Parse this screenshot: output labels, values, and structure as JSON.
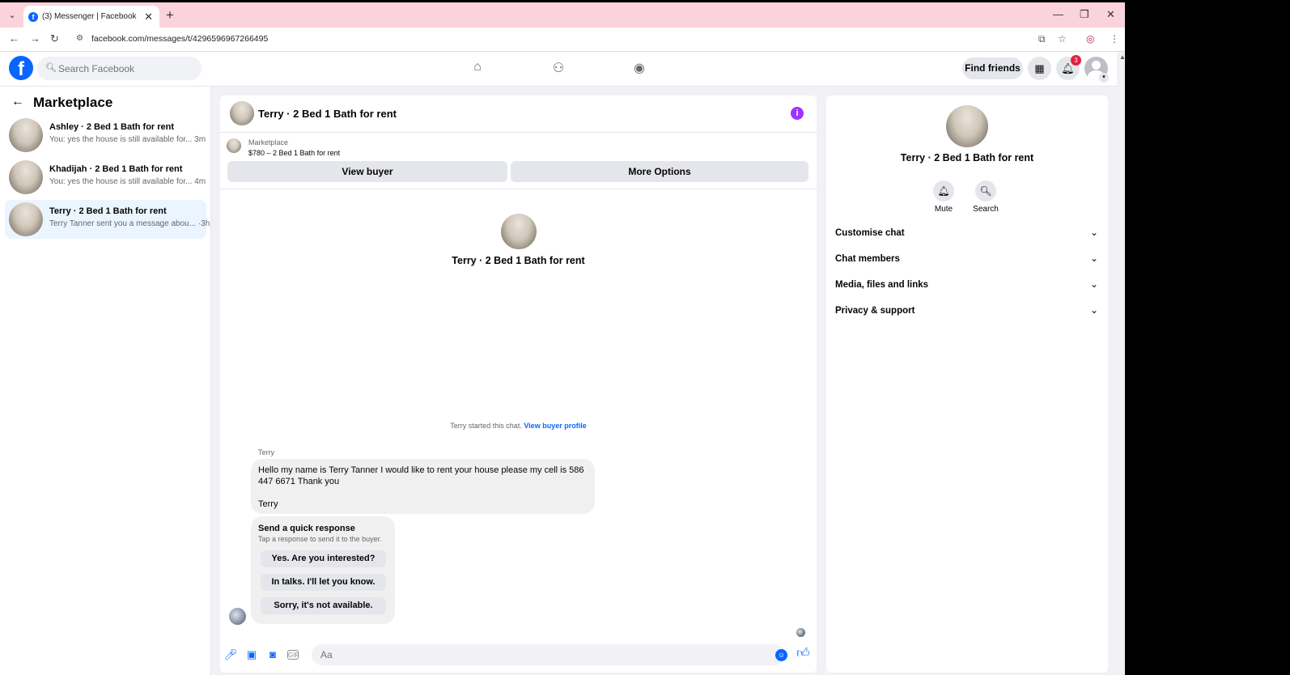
{
  "browser": {
    "tab_title": "(3) Messenger | Facebook",
    "tab_favicon": "f",
    "url": "facebook.com/messages/t/4296596967266495",
    "icons": [
      "tab-list-icon",
      "close-tab-icon",
      "new-tab-icon",
      "minimize-icon",
      "restore-icon",
      "close-window-icon",
      "back-icon",
      "forward-icon",
      "reload-icon",
      "site-info-icon",
      "install-app-icon",
      "bookmark-star-icon",
      "profile-icon",
      "browser-menu-icon"
    ]
  },
  "fb": {
    "logo": "f",
    "search_placeholder": "Search Facebook",
    "find_friends": "Find friends",
    "notif_count": "3",
    "brand_color": "#0866ff"
  },
  "sidebar": {
    "title": "Marketplace",
    "conversations": [
      {
        "name": "Ashley · 2 Bed 1 Bath for rent",
        "snippet": "You: yes the house is still available for... 3m"
      },
      {
        "name": "Khadijah · 2 Bed 1 Bath for rent",
        "snippet": "You: yes the house is still available for... 4m"
      },
      {
        "name": "Terry · 2 Bed 1 Bath for rent",
        "snippet": "Terry Tanner sent you a message abou... ·3h"
      }
    ]
  },
  "chat": {
    "title": "Terry · 2 Bed 1 Bath for rent",
    "marketplace_label": "Marketplace",
    "listing": "$780 – 2 Bed 1 Bath for rent",
    "view_buyer": "View buyer",
    "more_options": "More Options",
    "intro_name": "Terry · 2 Bed 1 Bath for rent",
    "started_text": "Terry started this chat.",
    "view_buyer_profile": "View buyer profile",
    "sender": "Terry",
    "message_line1": "Hello my name is Terry Tanner I would like to rent your house please my cell is 586 447 6671 Thank you",
    "message_line2": "Terry",
    "quick_title": "Send a quick response",
    "quick_subtitle": "Tap a response to send it to the buyer.",
    "quick_replies": [
      "Yes. Are you interested?",
      "In talks. I'll let you know.",
      "Sorry, it's not available."
    ],
    "input_placeholder": "Aa",
    "gif_label": "GIF"
  },
  "info_panel": {
    "name": "Terry · 2 Bed 1 Bath for rent",
    "mute": "Mute",
    "search": "Search",
    "sections": [
      "Customise chat",
      "Chat members",
      "Media, files and links",
      "Privacy & support"
    ]
  }
}
